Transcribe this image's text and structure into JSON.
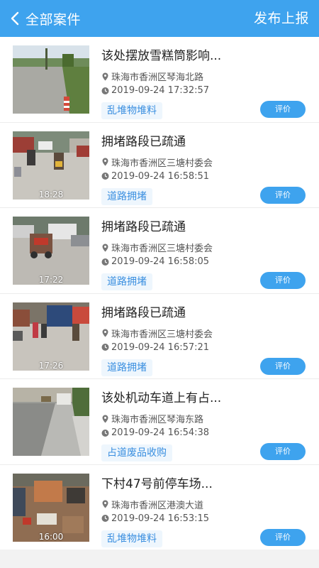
{
  "header": {
    "back_label": "全部案件",
    "publish_label": "发布上报"
  },
  "colors": {
    "accent": "#3ea3ee",
    "tag_text": "#3a8fe0",
    "tag_bg": "#eef6fd"
  },
  "cases": [
    {
      "title": "该处摆放雪糕筒影响...",
      "location": "珠海市香洲区琴海北路",
      "time": "2019-09-24 17:32:57",
      "category": "乱堆物堆料",
      "rate_label": "评价",
      "video_time": ""
    },
    {
      "title": "拥堵路段已疏通",
      "location": "珠海市香洲区三塘村委会",
      "time": "2019-09-24 16:58:51",
      "category": "道路拥堵",
      "rate_label": "评价",
      "video_time": "18:28"
    },
    {
      "title": "拥堵路段已疏通",
      "location": "珠海市香洲区三塘村委会",
      "time": "2019-09-24 16:58:05",
      "category": "道路拥堵",
      "rate_label": "评价",
      "video_time": "17:22"
    },
    {
      "title": "拥堵路段已疏通",
      "location": "珠海市香洲区三塘村委会",
      "time": "2019-09-24 16:57:21",
      "category": "道路拥堵",
      "rate_label": "评价",
      "video_time": "17:26"
    },
    {
      "title": "该处机动车道上有占...",
      "location": "珠海市香洲区琴海东路",
      "time": "2019-09-24 16:54:38",
      "category": "占道废品收购",
      "rate_label": "评价",
      "video_time": ""
    },
    {
      "title": "下村47号前停车场...",
      "location": "珠海市香洲区港澳大道",
      "time": "2019-09-24 16:53:15",
      "category": "乱堆物堆料",
      "rate_label": "评价",
      "video_time": "16:00"
    }
  ]
}
